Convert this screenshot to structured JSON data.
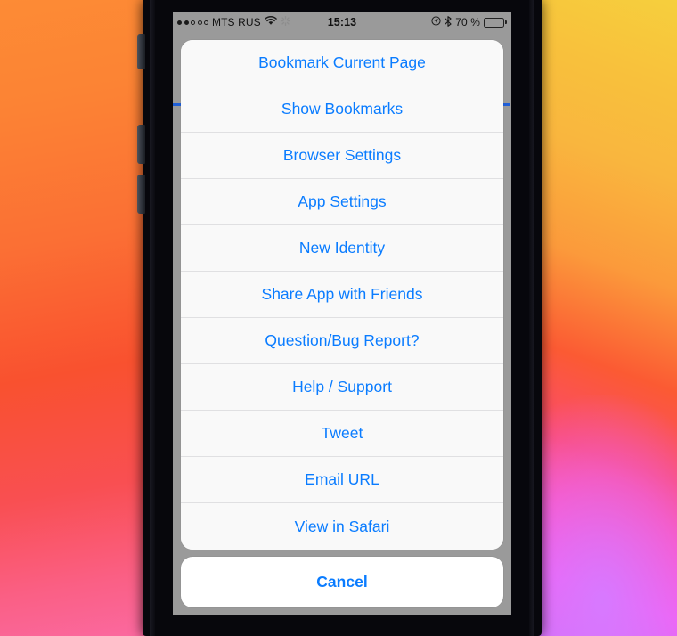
{
  "status_bar": {
    "signal_dots_total": 5,
    "signal_dots_filled": 2,
    "carrier": "MTS RUS",
    "wifi_icon": "wifi-icon",
    "sync_icon": "sync-spinner-icon",
    "time": "15:13",
    "location_icon": "location-services-icon",
    "bluetooth_icon": "bluetooth-icon",
    "battery_percent": "70 %",
    "battery_level": 70,
    "battery_icon": "battery-icon"
  },
  "action_sheet": {
    "items": [
      {
        "label": "Bookmark Current Page"
      },
      {
        "label": "Show Bookmarks"
      },
      {
        "label": "Browser Settings"
      },
      {
        "label": "App Settings"
      },
      {
        "label": "New Identity"
      },
      {
        "label": "Share App with Friends"
      },
      {
        "label": "Question/Bug Report?"
      },
      {
        "label": "Help / Support"
      },
      {
        "label": "Tweet"
      },
      {
        "label": "Email URL"
      },
      {
        "label": "View in Safari"
      }
    ],
    "cancel_label": "Cancel"
  },
  "colors": {
    "accent_blue": "#0a7cff",
    "sheet_background": "#f9f9f9",
    "cancel_background": "#ffffff",
    "screen_dim": "#9a9a9a",
    "progress_bar": "#1f5fd8"
  }
}
